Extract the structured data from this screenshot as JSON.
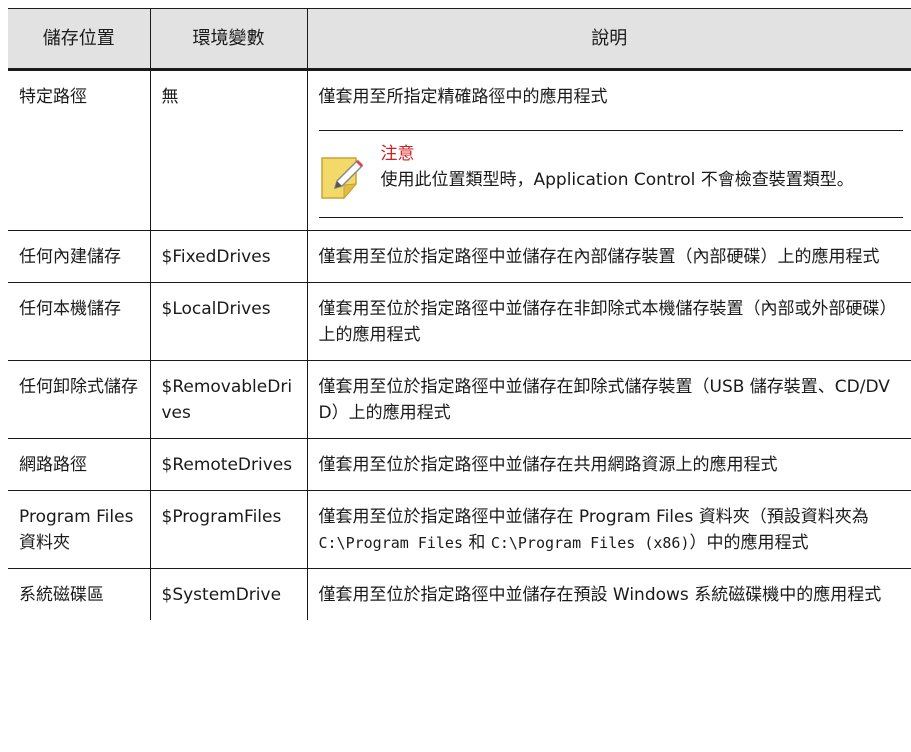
{
  "table": {
    "headers": [
      "儲存位置",
      "環境變數",
      "說明"
    ],
    "rows": [
      {
        "location": "特定路徑",
        "variable": "無",
        "description": "僅套用至所指定精確路徑中的應用程式"
      },
      {
        "location": "任何內建儲存",
        "variable": "$FixedDrives",
        "description": "僅套用至位於指定路徑中並儲存在內部儲存裝置（內部硬碟）上的應用程式"
      },
      {
        "location": "任何本機儲存",
        "variable": "$LocalDrives",
        "description": "僅套用至位於指定路徑中並儲存在非卸除式本機儲存裝置（內部或外部硬碟）上的應用程式"
      },
      {
        "location": "任何卸除式儲存",
        "variable": "$RemovableDrives",
        "description": "僅套用至位於指定路徑中並儲存在卸除式儲存裝置（USB 儲存裝置、CD/DVD）上的應用程式"
      },
      {
        "location": "網路路徑",
        "variable": "$RemoteDrives",
        "description": "僅套用至位於指定路徑中並儲存在共用網路資源上的應用程式"
      },
      {
        "location": "Program Files 資料夾",
        "variable": "$ProgramFiles",
        "description_pre": "僅套用至位於指定路徑中並儲存在 Program Files 資料夾（預設資料夾為 ",
        "path1": "C:\\Program Files",
        "description_mid": " 和 ",
        "path2": "C:\\Program Files (x86)",
        "description_post": "）中的應用程式"
      },
      {
        "location": "系統磁碟區",
        "variable": "$SystemDrive",
        "description": "僅套用至位於指定路徑中並儲存在預設 Windows 系統磁碟機中的應用程式"
      }
    ]
  },
  "note": {
    "icon": "note-pencil-icon",
    "title": "注意",
    "text": "使用此位置類型時，Application Control 不會檢查裝置類型。"
  },
  "colors": {
    "header_bg": "#e2e2e2",
    "note_title": "#d21e1e",
    "icon_fill": "#f3d86a"
  }
}
